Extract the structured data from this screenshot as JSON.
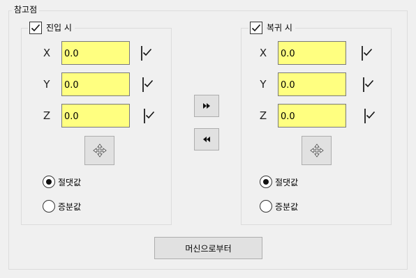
{
  "main_group": {
    "title": "참고점"
  },
  "entry": {
    "label": "진입 시",
    "enabled": true,
    "axes": [
      {
        "axis": "X",
        "value": "0.0",
        "checked": true
      },
      {
        "axis": "Y",
        "value": "0.0",
        "checked": true
      },
      {
        "axis": "Z",
        "value": "0.0",
        "checked": true
      }
    ],
    "mode_absolute": "절댓값",
    "mode_incremental": "증분값",
    "selected_mode": "absolute"
  },
  "return": {
    "label": "복귀 시",
    "enabled": true,
    "axes": [
      {
        "axis": "X",
        "value": "0.0",
        "checked": true
      },
      {
        "axis": "Y",
        "value": "0.0",
        "checked": true
      },
      {
        "axis": "Z",
        "value": "0.0",
        "checked": true
      }
    ],
    "mode_absolute": "절댓값",
    "mode_incremental": "증분값",
    "selected_mode": "absolute"
  },
  "buttons": {
    "from_machine": "머신으로부터"
  },
  "icons": {
    "copy_right": "fast-forward-icon",
    "copy_left": "rewind-icon",
    "move": "move-cross-icon"
  },
  "colors": {
    "field_bg": "#ffff80",
    "window_bg": "#f0f0f0"
  }
}
